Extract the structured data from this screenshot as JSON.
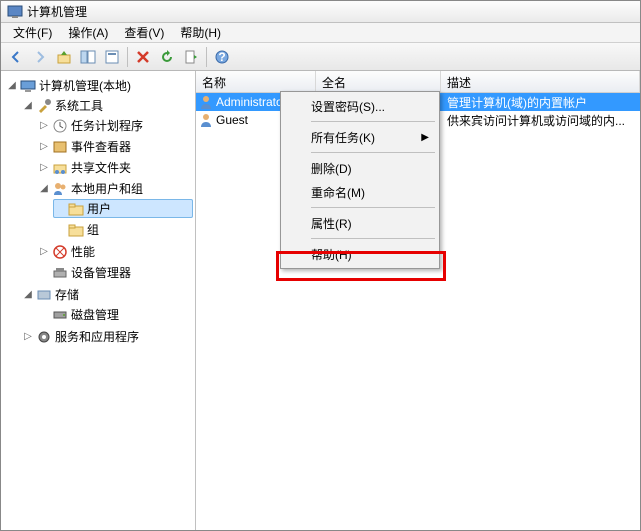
{
  "window": {
    "title": "计算机管理"
  },
  "menu": {
    "file": "文件(F)",
    "action": "操作(A)",
    "view": "查看(V)",
    "help": "帮助(H)"
  },
  "tree": {
    "root": "计算机管理(本地)",
    "systools": "系统工具",
    "taskScheduler": "任务计划程序",
    "eventViewer": "事件查看器",
    "sharedFolders": "共享文件夹",
    "localUsersGroups": "本地用户和组",
    "users": "用户",
    "groups": "组",
    "performance": "性能",
    "deviceManager": "设备管理器",
    "storage": "存储",
    "diskMgmt": "磁盘管理",
    "servicesApps": "服务和应用程序"
  },
  "columns": {
    "name": "名称",
    "fullname": "全名",
    "desc": "描述"
  },
  "rows": [
    {
      "name": "Administrator",
      "fullname": "",
      "desc": "管理计算机(域)的内置帐户",
      "selected": true
    },
    {
      "name": "Guest",
      "fullname": "",
      "desc": "供来宾访问计算机或访问域的内...",
      "selected": false
    }
  ],
  "context": {
    "setPwd": "设置密码(S)...",
    "allTasks": "所有任务(K)",
    "delete": "删除(D)",
    "rename": "重命名(M)",
    "properties": "属性(R)",
    "help": "帮助(H)"
  }
}
